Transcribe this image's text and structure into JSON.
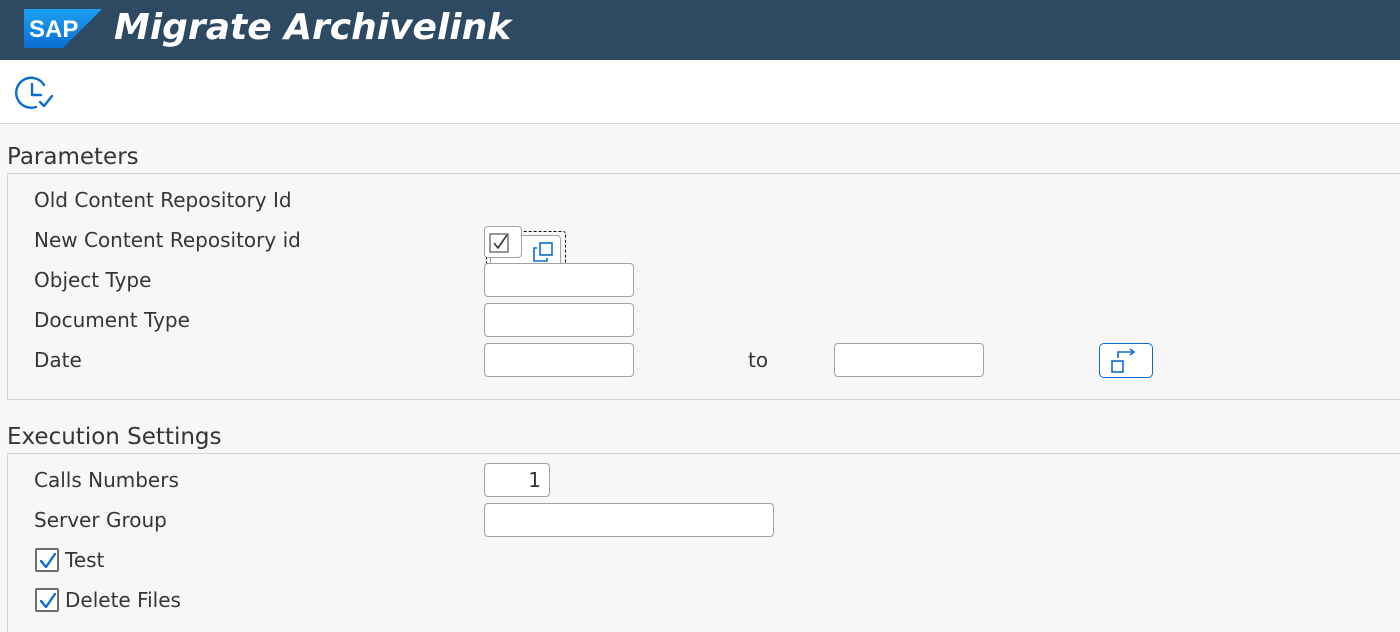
{
  "header": {
    "logo_text": "SAP",
    "title": "Migrate Archivelink",
    "brand_color": "#2e4a62"
  },
  "toolbar": {
    "execute_icon": "execute-clock-check-icon"
  },
  "parameters": {
    "title": "Parameters",
    "old_repo_label": "Old Content Repository Id",
    "old_repo_value": "",
    "new_repo_label": "New Content Repository id",
    "new_repo_checked": true,
    "object_type_label": "Object Type",
    "object_type_value": "",
    "document_type_label": "Document Type",
    "document_type_value": "",
    "date_label": "Date",
    "date_from_value": "",
    "date_to_label": "to",
    "date_to_value": "",
    "multiple_selection_icon": "multiple-selection-icon"
  },
  "execution": {
    "title": "Execution Settings",
    "calls_label": "Calls Numbers",
    "calls_value": "1",
    "server_group_label": "Server Group",
    "server_group_value": "",
    "test_label": "Test",
    "test_checked": true,
    "delete_label": "Delete Files",
    "delete_checked": true
  },
  "colors": {
    "accent": "#0a6ed1",
    "checkbox_check": "#0a6ed1"
  }
}
